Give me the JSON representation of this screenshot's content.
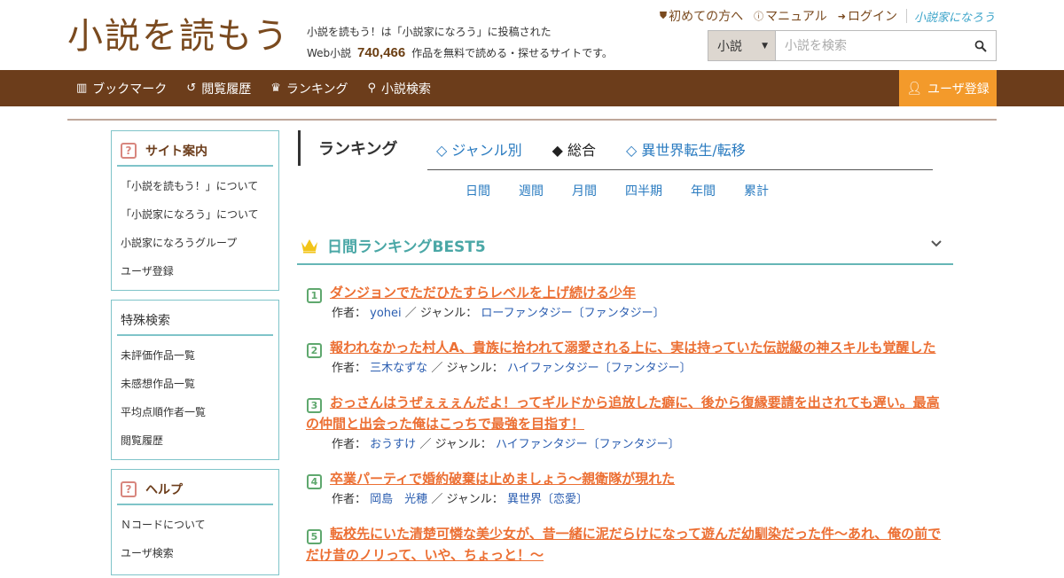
{
  "header": {
    "tagline_line1": "小説を読もう！は「小説家になろう」に投稿された",
    "tagline_prefix": "Web小説",
    "tagline_count": "740,466",
    "tagline_suffix": "作品を無料で読める・探せるサイトです。",
    "links": [
      {
        "label": "初めての方へ",
        "icon": "shield-icon"
      },
      {
        "label": "マニュアル",
        "icon": "help-circle-icon"
      },
      {
        "label": "ログイン",
        "icon": "login-icon"
      }
    ],
    "partner_logo": "小説家になろう"
  },
  "search": {
    "select_value": "小説",
    "placeholder": "小説を検索"
  },
  "nav": {
    "items": [
      {
        "label": "ブックマーク",
        "icon": "bookmark-icon"
      },
      {
        "label": "閲覧履歴",
        "icon": "history-icon"
      },
      {
        "label": "ランキング",
        "icon": "crown-icon"
      },
      {
        "label": "小説検索",
        "icon": "search-icon"
      }
    ],
    "register_label": "ユーザ登録"
  },
  "sidebar": {
    "site_guide": {
      "title": "サイト案内",
      "items": [
        "「小説を読もう！」について",
        "「小説家になろう」について",
        "小説家になろうグループ",
        "ユーザ登録"
      ]
    },
    "special_search": {
      "title": "特殊検索",
      "items": [
        "未評価作品一覧",
        "未感想作品一覧",
        "平均点順作者一覧",
        "閲覧履歴"
      ]
    },
    "help": {
      "title": "ヘルプ",
      "items": [
        "Ｎコードについて",
        "ユーザ検索"
      ]
    }
  },
  "ranking": {
    "title": "ランキング",
    "tabs": [
      "◇ ジャンル別",
      "◆ 総合",
      "◇ 異世界転生/転移"
    ],
    "periods": [
      "日間",
      "週間",
      "月間",
      "四半期",
      "年間",
      "累計"
    ],
    "best_title": "日間ランキングBEST5",
    "author_label": "作者：",
    "genre_label": "／ ジャンル：",
    "items": [
      {
        "rank": "1",
        "title": "ダンジョンでただひたすらレベルを上げ続ける少年",
        "author": "yohei",
        "genre": "ローファンタジー〔ファンタジー〕"
      },
      {
        "rank": "2",
        "title": "報われなかった村人A、貴族に拾われて溺愛される上に、実は持っていた伝説級の神スキルも覚醒した",
        "author": "三木なずな",
        "genre": "ハイファンタジー〔ファンタジー〕"
      },
      {
        "rank": "3",
        "title": "おっさんはうぜぇぇぇんだよ！ってギルドから追放した癖に、後から復縁要請を出されても遅い。最高の仲間と出会った俺はこっちで最強を目指す！",
        "author": "おうすけ",
        "genre": "ハイファンタジー〔ファンタジー〕"
      },
      {
        "rank": "4",
        "title": "卒業パーティで婚約破棄は止めましょう～親衛隊が現れた",
        "author": "岡島　光穂",
        "genre": "異世界〔恋愛〕"
      },
      {
        "rank": "5",
        "title": "転校先にいた清楚可憐な美少女が、昔一緒に泥だらけになって遊んだ幼馴染だった件～あれ、俺の前でだけ昔のノリって、いや、ちょっと！～",
        "author": "",
        "genre": ""
      }
    ]
  },
  "colors": {
    "brown": "#6c3d1b",
    "orange": "#f39a2b",
    "teal": "#4aa7a6",
    "title_orange": "#ec6f33",
    "link_blue": "#2a7bc0"
  }
}
